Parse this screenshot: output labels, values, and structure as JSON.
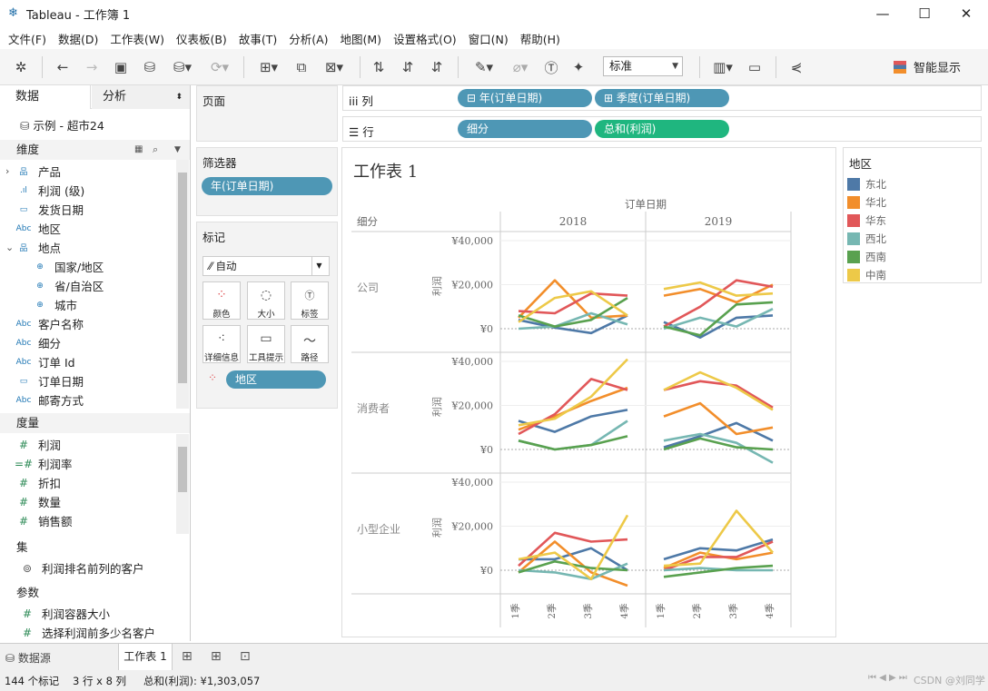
{
  "window": {
    "title": "Tableau - 工作簿 1",
    "controls": [
      "—",
      "☐",
      "✕"
    ]
  },
  "menu": [
    "文件(F)",
    "数据(D)",
    "工作表(W)",
    "仪表板(B)",
    "故事(T)",
    "分析(A)",
    "地图(M)",
    "设置格式(O)",
    "窗口(N)",
    "帮助(H)"
  ],
  "toolbar": {
    "standard": "标准",
    "smart_show": "智能显示"
  },
  "left": {
    "tab_data": "数据",
    "tab_analysis": "分析",
    "datasource": "示例 - 超市24",
    "dimensions_label": "维度",
    "dimensions": [
      {
        "icon": "hierarchy",
        "label": "产品",
        "expand": "›"
      },
      {
        "icon": "bin",
        "label": "利润 (级)"
      },
      {
        "icon": "date",
        "label": "发货日期"
      },
      {
        "icon": "abc",
        "label": "地区"
      },
      {
        "icon": "hierarchy",
        "label": "地点",
        "expand": "⌄"
      },
      {
        "icon": "globe",
        "label": "国家/地区",
        "indent": true
      },
      {
        "icon": "globe",
        "label": "省/自治区",
        "indent": true
      },
      {
        "icon": "globe",
        "label": "城市",
        "indent": true
      },
      {
        "icon": "abc",
        "label": "客户名称"
      },
      {
        "icon": "abc",
        "label": "细分"
      },
      {
        "icon": "abc",
        "label": "订单 Id"
      },
      {
        "icon": "date",
        "label": "订单日期"
      },
      {
        "icon": "abc",
        "label": "邮寄方式"
      }
    ],
    "measures_label": "度量",
    "measures": [
      "利润",
      "利润率",
      "折扣",
      "数量",
      "销售额"
    ],
    "sets_label": "集",
    "sets": [
      "利润排名前列的客户"
    ],
    "params_label": "参数",
    "params": [
      "利润容器大小",
      "选择利润前多少名客户"
    ]
  },
  "cards": {
    "pages": "页面",
    "filters": "筛选器",
    "filter_pill": "年(订单日期)",
    "marks": "标记",
    "mark_type": "自动",
    "mark_buttons": [
      "颜色",
      "大小",
      "标签",
      "详细信息",
      "工具提示",
      "路径"
    ],
    "color_pill": "地区"
  },
  "shelves": {
    "columns_label": "列",
    "columns": [
      "年(订单日期)",
      "季度(订单日期)"
    ],
    "rows_label": "行",
    "rows": [
      "细分",
      "总和(利润)"
    ]
  },
  "viz": {
    "title": "工作表 1",
    "col_header": "订单日期",
    "row_header": "细分",
    "years": [
      "2018",
      "2019"
    ],
    "segments": [
      "公司",
      "消费者",
      "小型企业"
    ],
    "yaxis_title": "利润",
    "yticks": [
      "¥40,000",
      "¥20,000",
      "¥0"
    ],
    "quarters": [
      "1季",
      "2季",
      "3季",
      "4季"
    ]
  },
  "legend": {
    "title": "地区",
    "items": [
      {
        "name": "东北",
        "color": "#4e79a7"
      },
      {
        "name": "华北",
        "color": "#f28e2b"
      },
      {
        "name": "华东",
        "color": "#e15759"
      },
      {
        "name": "西北",
        "color": "#76b7b2"
      },
      {
        "name": "西南",
        "color": "#59a14f"
      },
      {
        "name": "中南",
        "color": "#edc948"
      }
    ]
  },
  "bottom_tabs": {
    "datasource": "数据源",
    "sheet": "工作表 1"
  },
  "status": {
    "marks": "144 个标记",
    "dims": "3 行 x 8 列",
    "sum": "总和(利润): ¥1,303,057",
    "watermark": "CSDN @刘同学"
  },
  "chart_data": {
    "type": "line",
    "x": [
      "2018 1季",
      "2018 2季",
      "2018 3季",
      "2018 4季",
      "2019 1季",
      "2019 2季",
      "2019 3季",
      "2019 4季"
    ],
    "ylim": [
      -10000,
      45000
    ],
    "panels": [
      {
        "segment": "公司",
        "series": [
          {
            "name": "东北",
            "values": [
              4000,
              500,
              -2000,
              6000,
              3000,
              -4000,
              5000,
              6000
            ]
          },
          {
            "name": "华北",
            "values": [
              5000,
              22000,
              5000,
              6000,
              15000,
              18000,
              12000,
              20000
            ]
          },
          {
            "name": "华东",
            "values": [
              8000,
              7000,
              16000,
              15000,
              1000,
              10000,
              22000,
              19000
            ]
          },
          {
            "name": "西北",
            "values": [
              0,
              1000,
              7000,
              2000,
              0,
              5000,
              1000,
              9000
            ]
          },
          {
            "name": "西南",
            "values": [
              6000,
              1000,
              4000,
              14000,
              1000,
              -3000,
              11000,
              12000
            ]
          },
          {
            "name": "中南",
            "values": [
              3000,
              14000,
              17000,
              6000,
              18000,
              21000,
              15000,
              16000
            ]
          }
        ]
      },
      {
        "segment": "消费者",
        "series": [
          {
            "name": "东北",
            "values": [
              13000,
              8000,
              15000,
              18000,
              1000,
              6000,
              12000,
              4000
            ]
          },
          {
            "name": "华北",
            "values": [
              9000,
              15000,
              22000,
              28000,
              15000,
              21000,
              7000,
              10000
            ]
          },
          {
            "name": "华东",
            "values": [
              7000,
              16000,
              32000,
              27000,
              27000,
              31000,
              29000,
              19000
            ]
          },
          {
            "name": "西北",
            "values": [
              4000,
              0,
              2000,
              13000,
              4000,
              7000,
              3000,
              -6000
            ]
          },
          {
            "name": "西南",
            "values": [
              4000,
              0,
              2000,
              6000,
              0,
              5000,
              1000,
              0
            ]
          },
          {
            "name": "中南",
            "values": [
              11000,
              14000,
              24000,
              41000,
              27000,
              35000,
              28000,
              18000
            ]
          }
        ]
      },
      {
        "segment": "小型企业",
        "series": [
          {
            "name": "东北",
            "values": [
              5000,
              5000,
              10000,
              0,
              5000,
              10000,
              9000,
              14000
            ]
          },
          {
            "name": "华北",
            "values": [
              -1000,
              13000,
              -1000,
              -7000,
              1000,
              8000,
              5000,
              8000
            ]
          },
          {
            "name": "华东",
            "values": [
              2000,
              17000,
              13000,
              14000,
              0,
              6000,
              6000,
              13000
            ]
          },
          {
            "name": "西北",
            "values": [
              0,
              -1000,
              -4000,
              3000,
              0,
              1000,
              0,
              0
            ]
          },
          {
            "name": "西南",
            "values": [
              -1000,
              4000,
              1000,
              0,
              -3000,
              -1000,
              1000,
              2000
            ]
          },
          {
            "name": "中南",
            "values": [
              5000,
              8000,
              -4000,
              25000,
              2000,
              3000,
              27000,
              8000
            ]
          }
        ]
      }
    ]
  }
}
